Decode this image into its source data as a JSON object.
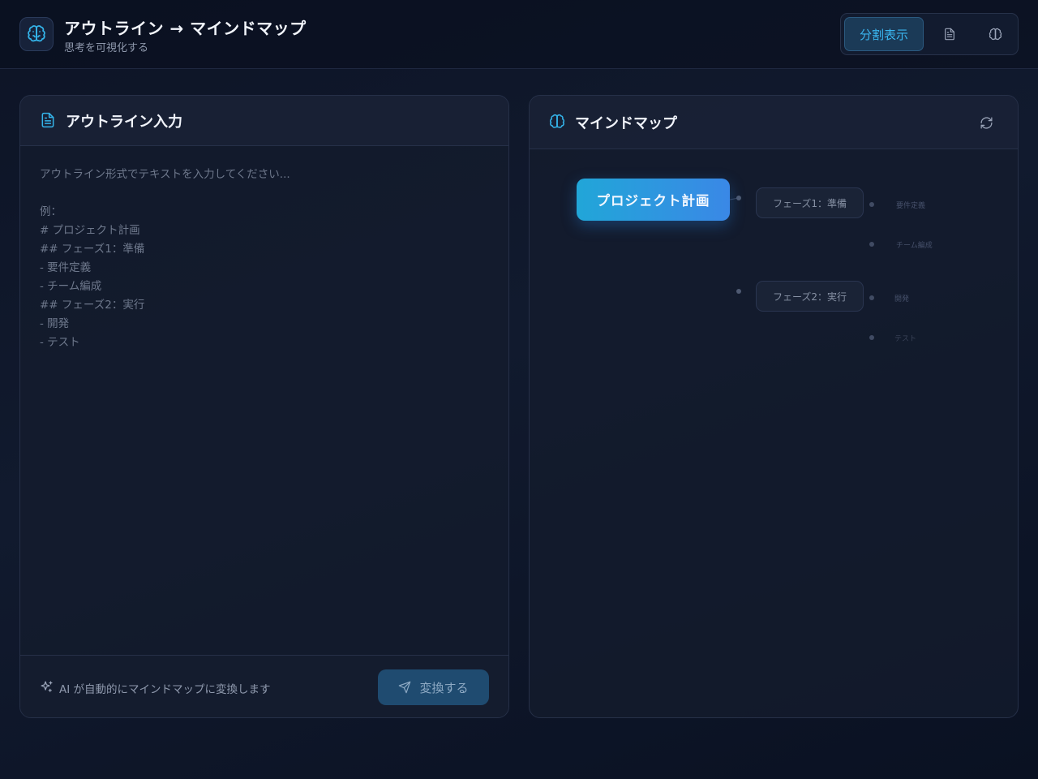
{
  "header": {
    "title": "アウトライン → マインドマップ",
    "subtitle": "思考を可視化する",
    "logo_icon": "brain-icon",
    "view_switch": {
      "split_label": "分割表示",
      "outline_icon": "document-icon",
      "mindmap_icon": "brain-icon",
      "active": "split"
    }
  },
  "outline_panel": {
    "title": "アウトライン入力",
    "title_icon": "document-icon",
    "value": "",
    "placeholder": "アウトライン形式でテキストを入力してください...\n\n例：\n# プロジェクト計画\n## フェーズ1：準備\n- 要件定義\n- チーム編成\n## フェーズ2：実行\n- 開発\n- テスト",
    "footer_icon": "sparkles-icon",
    "footer_text": "AI が自動的にマインドマップに変換します",
    "convert_label": "変換する",
    "convert_icon": "send-icon"
  },
  "mindmap_panel": {
    "title": "マインドマップ",
    "title_icon": "brain-icon",
    "refresh_icon": "refresh-icon",
    "root": "プロジェクト計画",
    "branches": [
      {
        "label": "フェーズ1：準備",
        "leaves": [
          "要件定義",
          "チーム編成"
        ]
      },
      {
        "label": "フェーズ2：実行",
        "leaves": [
          "開発",
          "テスト"
        ]
      }
    ]
  },
  "colors": {
    "accent": "#3ab6f0",
    "root_gradient_start": "#21a6d8",
    "root_gradient_end": "#3a88e6",
    "background": "#0d1426",
    "panel": "#141c2e"
  }
}
